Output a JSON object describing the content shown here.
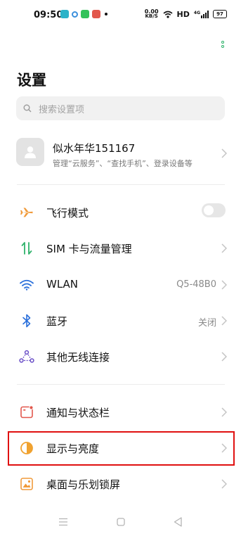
{
  "status_bar": {
    "time": "09:50",
    "net_speed_value": "0.00",
    "net_speed_unit": "KB/S",
    "hd_label": "HD",
    "signal_label": "4G",
    "battery": "97"
  },
  "header": {
    "title": "设置"
  },
  "search": {
    "placeholder": "搜索设置项"
  },
  "account": {
    "name": "似水年华151167",
    "description": "管理“云服务”、“查找手机”、登录设备等"
  },
  "settings": {
    "airplane": {
      "label": "飞行模式",
      "enabled": false
    },
    "sim": {
      "label": "SIM 卡与流量管理"
    },
    "wlan": {
      "label": "WLAN",
      "value": "Q5-48B0"
    },
    "bluetooth": {
      "label": "蓝牙",
      "value": "关闭"
    },
    "other_wireless": {
      "label": "其他无线连接"
    },
    "notifications": {
      "label": "通知与状态栏"
    },
    "display": {
      "label": "显示与亮度"
    },
    "desktop": {
      "label": "桌面与乐划锁屏"
    }
  },
  "colors": {
    "accent_green": "#2fb26b",
    "airplane_icon": "#f09a3a",
    "sim_icon": "#2fb26b",
    "wlan_icon": "#2a6fdb",
    "bluetooth_icon": "#2a6fdb",
    "wireless_icon": "#6a4fc7",
    "notification_icon": "#e2574c",
    "display_icon": "#f0a230",
    "desktop_icon": "#f09a3a",
    "highlight_border": "#e01010"
  },
  "icons": {
    "avatar": "person-icon",
    "airplane": "airplane-icon",
    "sim": "sim-transfer-icon",
    "wlan": "wifi-icon",
    "bluetooth": "bluetooth-icon",
    "other_wireless": "connection-icon",
    "notifications": "notification-icon",
    "display": "brightness-icon",
    "desktop": "wallpaper-icon"
  }
}
